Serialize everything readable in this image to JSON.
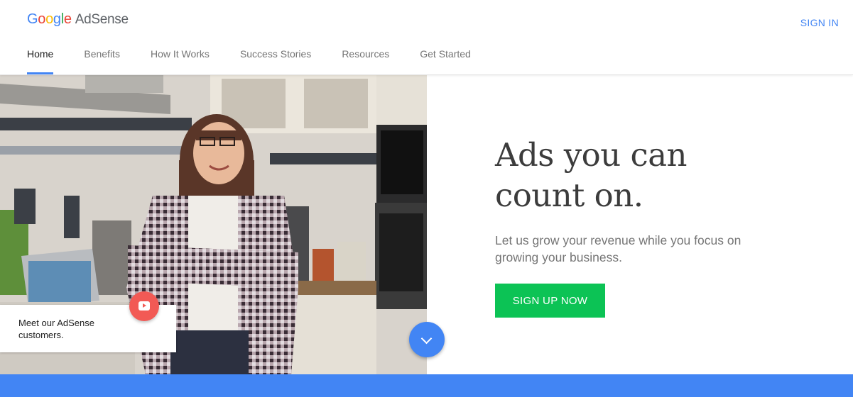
{
  "header": {
    "logo_word": "Google",
    "product_name": "AdSense",
    "signin_label": "SIGN IN"
  },
  "nav": {
    "items": [
      {
        "label": "Home",
        "active": true
      },
      {
        "label": "Benefits"
      },
      {
        "label": "How It Works"
      },
      {
        "label": "Success Stories"
      },
      {
        "label": "Resources"
      },
      {
        "label": "Get Started"
      }
    ]
  },
  "hero": {
    "headline_line1": "Ads you can",
    "headline_line2": "count on.",
    "subhead": "Let us grow your revenue while you focus on growing your business.",
    "cta_label": "SIGN UP NOW",
    "customers_text": "Meet our AdSense customers.",
    "play_icon": "youtube-play-icon",
    "scroll_icon": "chevron-down-icon"
  },
  "colors": {
    "accent_blue": "#4285f4",
    "cta_green": "#0cc355",
    "play_red": "#f25a55"
  }
}
